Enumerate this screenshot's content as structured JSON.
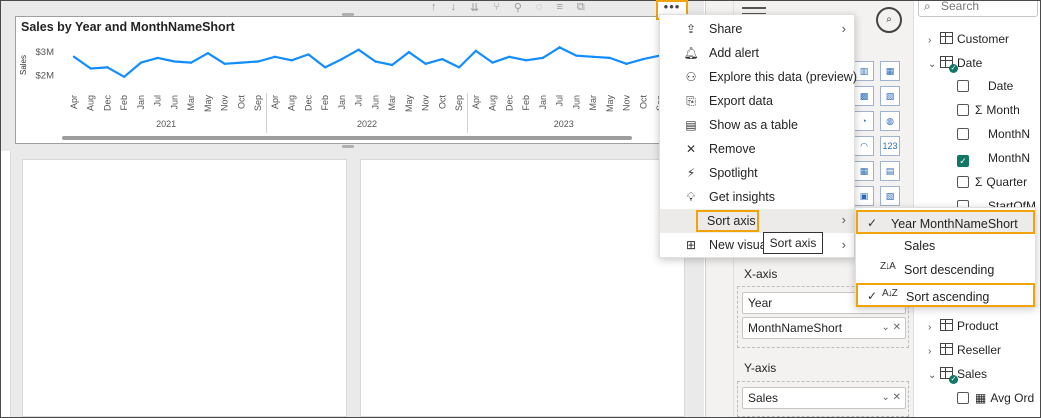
{
  "chart_visual": {
    "title": "Sales by Year and MonthNameShort"
  },
  "chart_data": {
    "type": "line",
    "title": "Sales by Year and MonthNameShort",
    "ylabel": "Sales",
    "xlabel": "",
    "yticks": [
      "$3M",
      "$2M"
    ],
    "ylim": [
      1.6,
      3.3
    ],
    "grid": false,
    "year_groups": [
      "2021",
      "2022",
      "2023"
    ],
    "categories": [
      "Apr",
      "Aug",
      "Dec",
      "Feb",
      "Jan",
      "Jul",
      "Jun",
      "Mar",
      "May",
      "Nov",
      "Oct",
      "Sep",
      "Apr",
      "Aug",
      "Dec",
      "Feb",
      "Jan",
      "Jul",
      "Jun",
      "Mar",
      "May",
      "Nov",
      "Oct",
      "Sep",
      "Apr",
      "Aug",
      "Dec",
      "Feb",
      "Jan",
      "Jul",
      "Jun",
      "Mar",
      "May",
      "Nov",
      "Oct",
      "Sep"
    ],
    "series": [
      {
        "color": "#118DFF",
        "values": [
          2.8,
          2.3,
          2.35,
          1.95,
          2.55,
          2.75,
          2.6,
          2.55,
          2.95,
          2.5,
          2.55,
          2.6,
          2.8,
          2.65,
          2.9,
          2.35,
          2.7,
          3.1,
          2.6,
          2.45,
          3.0,
          2.5,
          2.7,
          2.35,
          3.05,
          2.55,
          2.8,
          2.65,
          2.75,
          3.2,
          2.85,
          2.8,
          2.75,
          2.5,
          2.7,
          2.85
        ]
      }
    ]
  },
  "toolbar": {
    "more_options": "•••"
  },
  "context_menu": {
    "items": [
      {
        "icon": "share-icon",
        "glyph": "⇪",
        "label": "Share",
        "arrow": "›"
      },
      {
        "icon": "bell-icon",
        "glyph": "🔔︎",
        "label": "Add alert",
        "arrow": ""
      },
      {
        "icon": "binoculars-icon",
        "glyph": "⚇",
        "label": "Explore this data (preview)",
        "arrow": ""
      },
      {
        "icon": "export-icon",
        "glyph": "⎘",
        "label": "Export data",
        "arrow": ""
      },
      {
        "icon": "table-icon",
        "glyph": "▤",
        "label": "Show as a table",
        "arrow": ""
      },
      {
        "icon": "close-icon",
        "glyph": "✕",
        "label": "Remove",
        "arrow": ""
      },
      {
        "icon": "spotlight-icon",
        "glyph": "⚡",
        "label": "Spotlight",
        "arrow": ""
      },
      {
        "icon": "lightbulb-icon",
        "glyph": "💡︎",
        "label": "Get insights",
        "arrow": ""
      },
      {
        "icon": "",
        "glyph": "",
        "label": "Sort axis",
        "arrow": "›"
      },
      {
        "icon": "new-visual-icon",
        "glyph": "⊞",
        "label": "New visual",
        "arrow": "›"
      }
    ],
    "tooltip": "Sort axis"
  },
  "sort_submenu": {
    "items": [
      {
        "check": "✓",
        "icon": "",
        "label": "Year MonthNameShort"
      },
      {
        "check": "",
        "icon": "",
        "label": "Sales"
      },
      {
        "check": "",
        "icon": "Z↓A",
        "label": "Sort descending"
      },
      {
        "check": "✓",
        "icon": "A↓Z",
        "label": "Sort ascending"
      }
    ]
  },
  "visualizations_pane": {
    "xaxis_title": "X-axis",
    "xaxis_fields": [
      "Year",
      "MonthNameShort"
    ],
    "yaxis_title": "Y-axis",
    "yaxis_fields": [
      "Sales"
    ],
    "icon_grid": [
      "▥",
      "▦",
      "▩",
      "▧",
      "◔",
      "◍",
      "◠",
      "123",
      "▦",
      "▤",
      "▣",
      "▧"
    ]
  },
  "data_pane": {
    "search_placeholder": "Search",
    "tree": [
      {
        "label": "Customer",
        "kind": "table",
        "expanded": false
      },
      {
        "label": "Date",
        "kind": "table",
        "expanded": true
      },
      {
        "label": "Date",
        "kind": "field",
        "checked": false,
        "sigma": false
      },
      {
        "label": "Month",
        "kind": "field",
        "checked": false,
        "sigma": true
      },
      {
        "label": "MonthN",
        "kind": "field",
        "checked": false,
        "sigma": false
      },
      {
        "label": "MonthN",
        "kind": "field",
        "checked": true,
        "sigma": false
      },
      {
        "label": "Quarter",
        "kind": "field",
        "checked": false,
        "sigma": true
      },
      {
        "label": "StartOfM",
        "kind": "field",
        "checked": false,
        "sigma": false
      },
      {
        "label": "Product",
        "kind": "table",
        "expanded": false
      },
      {
        "label": "Reseller",
        "kind": "table",
        "expanded": false
      },
      {
        "label": "Sales",
        "kind": "table",
        "expanded": true
      },
      {
        "label": "Avg Ord",
        "kind": "field",
        "checked": false,
        "sigma": false
      }
    ]
  }
}
